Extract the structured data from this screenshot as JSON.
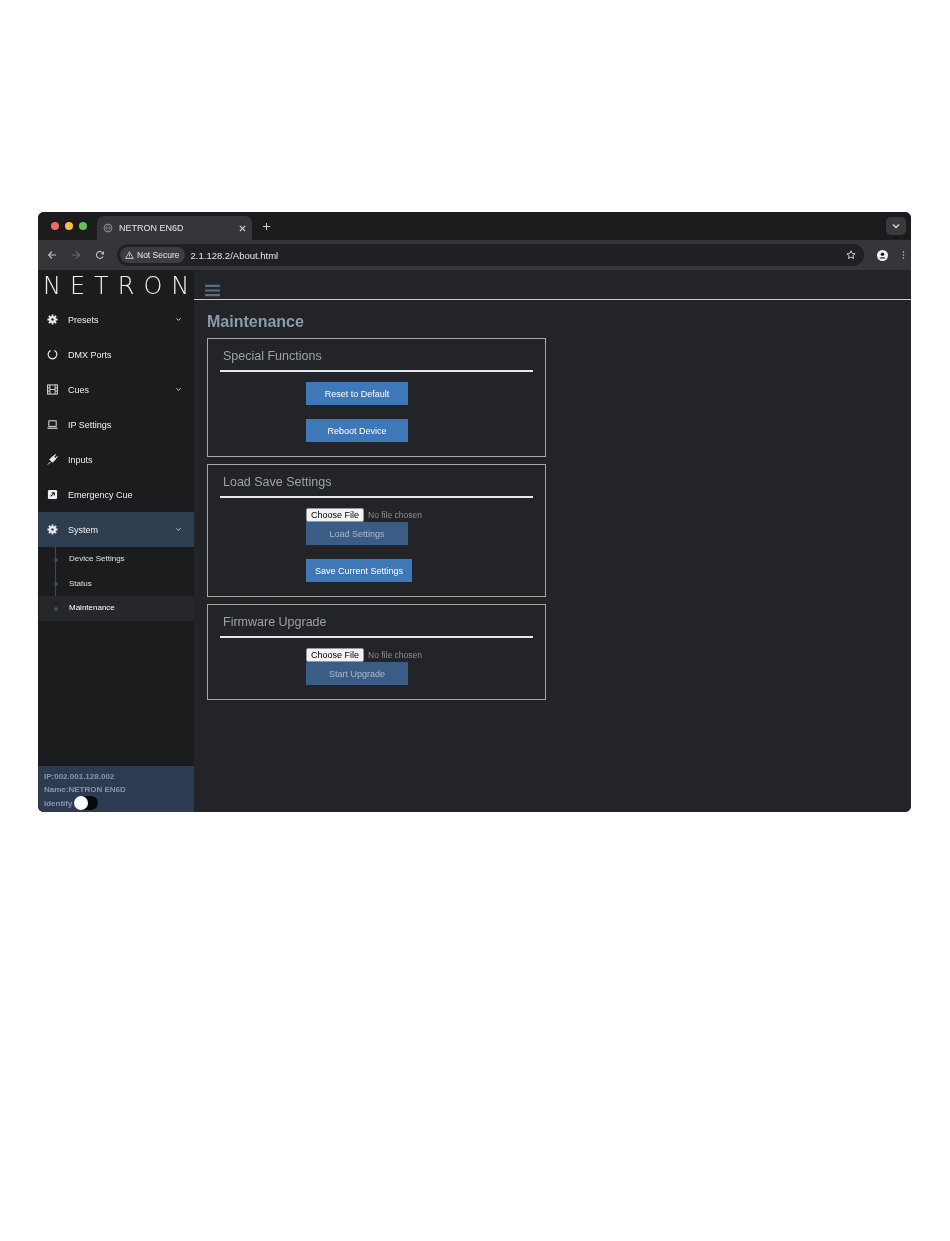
{
  "browser": {
    "tab_title": "NETRON EN6D",
    "security": "Not Secure",
    "url": "2.1.128.2/About.html"
  },
  "sidebar": {
    "logo": "NETRON",
    "items": [
      {
        "label": "Presets",
        "has_submenu": true,
        "selected": false
      },
      {
        "label": "DMX Ports",
        "has_submenu": false,
        "selected": false
      },
      {
        "label": "Cues",
        "has_submenu": true,
        "selected": false
      },
      {
        "label": "IP Settings",
        "has_submenu": false,
        "selected": false
      },
      {
        "label": "Inputs",
        "has_submenu": false,
        "selected": false
      },
      {
        "label": "Emergency Cue",
        "has_submenu": false,
        "selected": false
      },
      {
        "label": "System",
        "has_submenu": true,
        "selected": true,
        "children": [
          {
            "label": "Device Settings",
            "selected": false
          },
          {
            "label": "Status",
            "selected": false
          },
          {
            "label": "Maintenance",
            "selected": true
          }
        ]
      }
    ],
    "footer": {
      "ip": "IP:002.001.128.002",
      "name": "Name:NETRON EN6D",
      "identify": "Identify",
      "identify_on": false
    }
  },
  "main": {
    "title": "Maintenance",
    "panels": [
      {
        "title": "Special Functions",
        "controls": [
          {
            "kind": "button",
            "label": "Reset to Default",
            "disabled": false
          },
          {
            "kind": "button",
            "label": "Reboot Device",
            "disabled": false
          }
        ]
      },
      {
        "title": "Load Save Settings",
        "controls": [
          {
            "kind": "file",
            "button_label": "Choose File",
            "status": "No file chosen"
          },
          {
            "kind": "button",
            "label": "Load Settings",
            "disabled": true
          },
          {
            "kind": "button",
            "label": "Save Current Settings",
            "disabled": false
          }
        ]
      },
      {
        "title": "Firmware Upgrade",
        "controls": [
          {
            "kind": "file",
            "button_label": "Choose File",
            "status": "No file chosen"
          },
          {
            "kind": "button",
            "label": "Start Upgrade",
            "disabled": true
          }
        ]
      }
    ]
  }
}
